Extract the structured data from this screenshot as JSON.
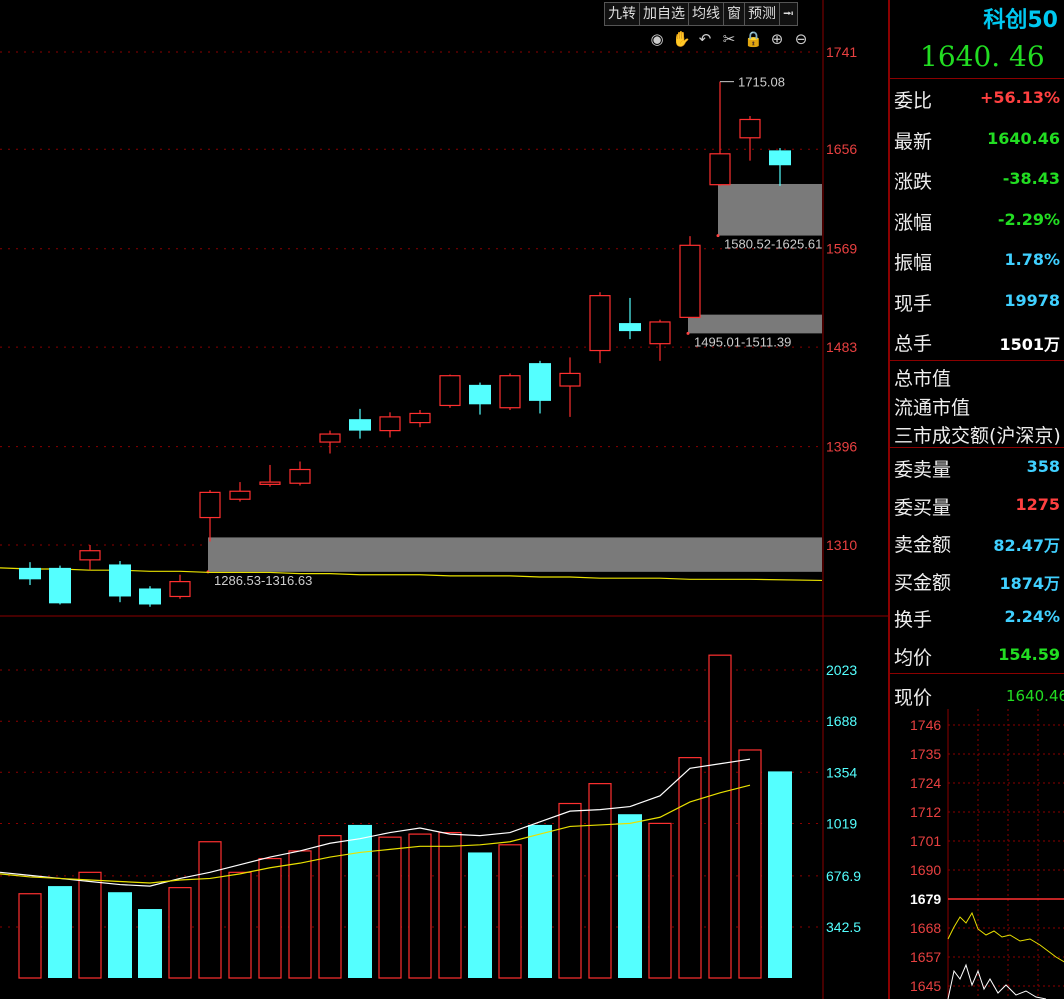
{
  "toolbar": {
    "buttons": [
      "九转",
      "加自选",
      "均线",
      "窗",
      "预测"
    ],
    "tools": [
      "eye-icon",
      "hand-icon",
      "undo-icon",
      "scissors-icon",
      "lock-icon",
      "zoom-in-icon",
      "zoom-out-icon"
    ]
  },
  "panel": {
    "title": "科创50",
    "price": "1640. 46",
    "rows": [
      {
        "label": "委比",
        "value": "+56.13%",
        "color": "#ff4040"
      },
      {
        "label": "最新",
        "value": "1640.46",
        "color": "#22dd22"
      },
      {
        "label": "涨跌",
        "value": "-38.43",
        "color": "#22dd22"
      },
      {
        "label": "涨幅",
        "value": "-2.29%",
        "color": "#22dd22"
      },
      {
        "label": "振幅",
        "value": "1.78%",
        "color": "#40d0ff"
      },
      {
        "label": "现手",
        "value": "19978",
        "color": "#40d0ff"
      },
      {
        "label": "总手",
        "value": "1501万",
        "color": "#ffffff"
      }
    ],
    "plain_labels": [
      "总市值",
      "流通市值",
      "三市成交额(沪深京)"
    ],
    "rows2": [
      {
        "label": "委卖量",
        "value": "358",
        "color": "#40d0ff"
      },
      {
        "label": "委买量",
        "value": "1275",
        "color": "#ff4040"
      },
      {
        "label": "卖金额",
        "value": "82.47万",
        "color": "#40d0ff"
      },
      {
        "label": "买金额",
        "value": "1874万",
        "color": "#40d0ff"
      },
      {
        "label": "换手",
        "value": "2.24%",
        "color": "#40d0ff"
      },
      {
        "label": "均价",
        "value": "154.59",
        "color": "#22dd22"
      }
    ],
    "mini_title": "现价",
    "mini_value": "1640.46",
    "mini_ticks": [
      "1746",
      "1735",
      "1724",
      "1712",
      "1701",
      "1690",
      "1679",
      "1668",
      "1657",
      "1645"
    ]
  },
  "chart_data": [
    {
      "type": "candlestick",
      "y_ticks": [
        1741,
        1656,
        1569,
        1483,
        1396,
        1310
      ],
      "ylim": [
        1225,
        1760
      ],
      "candles": [
        {
          "o": 1290,
          "c": 1280,
          "h": 1295,
          "l": 1275
        },
        {
          "o": 1290,
          "c": 1259,
          "h": 1292,
          "l": 1258
        },
        {
          "o": 1297,
          "c": 1305,
          "h": 1310,
          "l": 1288
        },
        {
          "o": 1293,
          "c": 1265,
          "h": 1296,
          "l": 1260
        },
        {
          "o": 1272,
          "c": 1258,
          "h": 1274,
          "l": 1256
        },
        {
          "o": 1265,
          "c": 1278,
          "h": 1284,
          "l": 1263
        },
        {
          "o": 1334,
          "c": 1356,
          "h": 1358,
          "l": 1313
        },
        {
          "o": 1350,
          "c": 1357,
          "h": 1365,
          "l": 1348
        },
        {
          "o": 1363,
          "c": 1365,
          "h": 1380,
          "l": 1361
        },
        {
          "o": 1364,
          "c": 1376,
          "h": 1383,
          "l": 1362
        },
        {
          "o": 1400,
          "c": 1407,
          "h": 1410,
          "l": 1390
        },
        {
          "o": 1420,
          "c": 1410,
          "h": 1429,
          "l": 1403
        },
        {
          "o": 1410,
          "c": 1422,
          "h": 1426,
          "l": 1404
        },
        {
          "o": 1417,
          "c": 1425,
          "h": 1428,
          "l": 1413
        },
        {
          "o": 1432,
          "c": 1458,
          "h": 1459,
          "l": 1430
        },
        {
          "o": 1450,
          "c": 1433,
          "h": 1452,
          "l": 1424
        },
        {
          "o": 1430,
          "c": 1458,
          "h": 1460,
          "l": 1428
        },
        {
          "o": 1469,
          "c": 1436,
          "h": 1471,
          "l": 1425
        },
        {
          "o": 1449,
          "c": 1460,
          "h": 1474,
          "l": 1422
        },
        {
          "o": 1480,
          "c": 1528,
          "h": 1531,
          "l": 1469
        },
        {
          "o": 1504,
          "c": 1497,
          "h": 1526,
          "l": 1490
        },
        {
          "o": 1486,
          "c": 1505,
          "h": 1507,
          "l": 1471
        },
        {
          "o": 1509,
          "c": 1572,
          "h": 1580,
          "l": 1509
        },
        {
          "o": 1625,
          "c": 1652,
          "h": 1715.08,
          "l": 1624
        },
        {
          "o": 1666,
          "c": 1682,
          "h": 1685,
          "l": 1646
        },
        {
          "o": 1655,
          "c": 1642,
          "h": 1657,
          "l": 1624
        }
      ],
      "gap_zones": [
        {
          "label": "1286.53-1316.63",
          "low": 1286.53,
          "high": 1316.63
        },
        {
          "label": "1495.01-1511.39",
          "low": 1495.01,
          "high": 1511.39
        },
        {
          "label": "1580.52-1625.61",
          "low": 1580.52,
          "high": 1625.61
        }
      ],
      "annotation": "1715.08",
      "ma_line": [
        1290,
        1289,
        1289,
        1288,
        1288,
        1287,
        1287,
        1286,
        1286,
        1286,
        1285,
        1285,
        1284,
        1284,
        1284,
        1283,
        1283,
        1283,
        1282,
        1282,
        1281,
        1281,
        1281,
        1280,
        1280,
        1280
      ]
    },
    {
      "type": "bar",
      "y_ticks": [
        "2023",
        "1688",
        "1354",
        "1019",
        "676.9",
        "342.5"
      ],
      "y_tick_values": [
        2023,
        1688,
        1354,
        1019,
        676.9,
        342.5
      ],
      "ylim": [
        0,
        2200
      ],
      "values": [
        560,
        610,
        700,
        570,
        460,
        600,
        900,
        700,
        790,
        840,
        940,
        1010,
        930,
        950,
        960,
        830,
        880,
        1010,
        1150,
        1280,
        1080,
        1020,
        1450,
        2120,
        1500,
        1360
      ],
      "up": [
        true,
        false,
        true,
        false,
        false,
        true,
        true,
        true,
        true,
        true,
        true,
        false,
        true,
        true,
        true,
        false,
        true,
        false,
        true,
        true,
        false,
        true,
        true,
        true,
        true,
        false
      ],
      "ma1": [
        700,
        680,
        660,
        640,
        620,
        610,
        660,
        700,
        750,
        800,
        840,
        890,
        920,
        960,
        990,
        950,
        940,
        960,
        1030,
        1100,
        1110,
        1130,
        1200,
        1380,
        1410,
        1440
      ],
      "ma2": [
        690,
        670,
        660,
        650,
        640,
        630,
        650,
        660,
        690,
        730,
        760,
        800,
        830,
        850,
        870,
        870,
        880,
        900,
        950,
        1000,
        1010,
        1020,
        1060,
        1160,
        1220,
        1270
      ]
    }
  ]
}
